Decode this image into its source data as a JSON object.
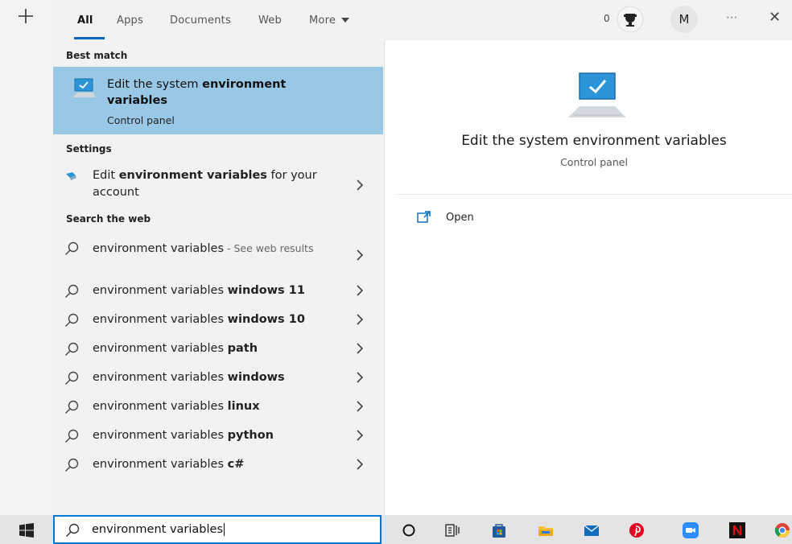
{
  "tabs": [
    {
      "label": "All"
    },
    {
      "label": "Apps"
    },
    {
      "label": "Documents"
    },
    {
      "label": "Web"
    },
    {
      "label": "More"
    }
  ],
  "header": {
    "reward_count": "0",
    "avatar_initial": "M",
    "more_options_glyph": "···",
    "close_glyph": "✕"
  },
  "sections": {
    "best_match": "Best match",
    "settings": "Settings",
    "search_web": "Search the web"
  },
  "best_match": {
    "title_plain": "Edit the system ",
    "title_bold": "environment variables",
    "subtitle": "Control panel",
    "icon": "monitor-check-icon"
  },
  "settings_items": [
    {
      "pre": "Edit ",
      "bold": "environment variables",
      "post": " for your account",
      "icon": "settings-app-icon"
    }
  ],
  "web_items": [
    {
      "plain": "environment variables",
      "bold": "",
      "suffix": " - See web results"
    },
    {
      "plain": "environment variables ",
      "bold": "windows 11",
      "suffix": ""
    },
    {
      "plain": "environment variables ",
      "bold": "windows 10",
      "suffix": ""
    },
    {
      "plain": "environment variables ",
      "bold": "path",
      "suffix": ""
    },
    {
      "plain": "environment variables ",
      "bold": "windows",
      "suffix": ""
    },
    {
      "plain": "environment variables ",
      "bold": "linux",
      "suffix": ""
    },
    {
      "plain": "environment variables ",
      "bold": "python",
      "suffix": ""
    },
    {
      "plain": "environment variables ",
      "bold": "c#",
      "suffix": ""
    }
  ],
  "preview": {
    "title": "Edit the system environment variables",
    "subtitle": "Control panel",
    "open_label": "Open"
  },
  "search": {
    "value": "environment variables"
  },
  "taskbar_icons": [
    "cortana-circle-icon",
    "task-view-icon",
    "microsoft-store-icon",
    "file-explorer-icon",
    "mail-icon",
    "pinterest-icon",
    "zoom-icon",
    "netflix-icon",
    "chrome-icon"
  ],
  "colors": {
    "accent": "#0078d7",
    "best_match_bg": "#99c8e6",
    "panel_bg": "#f2f2f2",
    "taskbar_bg": "#e4e4e4"
  }
}
